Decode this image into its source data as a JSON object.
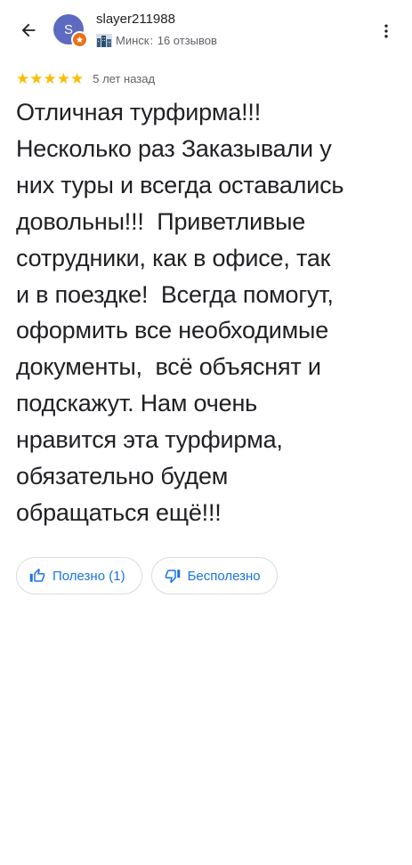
{
  "header": {
    "back_icon": "arrow-back-icon",
    "avatar_letter": "S",
    "avatar_color": "#5c6bc0",
    "badge_icon": "local-guide-star-icon",
    "badge_color": "#e8711a",
    "user_name": "slayer211988",
    "city_icon": "city-icon",
    "city": "Минск",
    "separator": ":",
    "reviews_count": "16 отзывов",
    "more_icon": "more-vert-icon"
  },
  "review": {
    "stars": 5,
    "star_color": "#fbbc04",
    "date": "5 лет назад",
    "text": "Отличная турфирма!!!\nНесколько раз Заказывали у\nних туры и всегда оставались\nдовольны!!!  Приветливые\nсотрудники, как в офисе, так\nи в поездке!  Всегда помогут,\nоформить все необходимые\nдокументы,  всё объяснят и\nподскажут. Нам очень\nнравится эта турфирма,\nобязательно будем\nобращаться ещё!!!"
  },
  "actions": {
    "helpful_icon": "thumb-up-icon",
    "helpful_label": "Полезно (1)",
    "unhelpful_icon": "thumb-down-icon",
    "unhelpful_label": "Бесполезно",
    "accent_color": "#1a73e8"
  }
}
